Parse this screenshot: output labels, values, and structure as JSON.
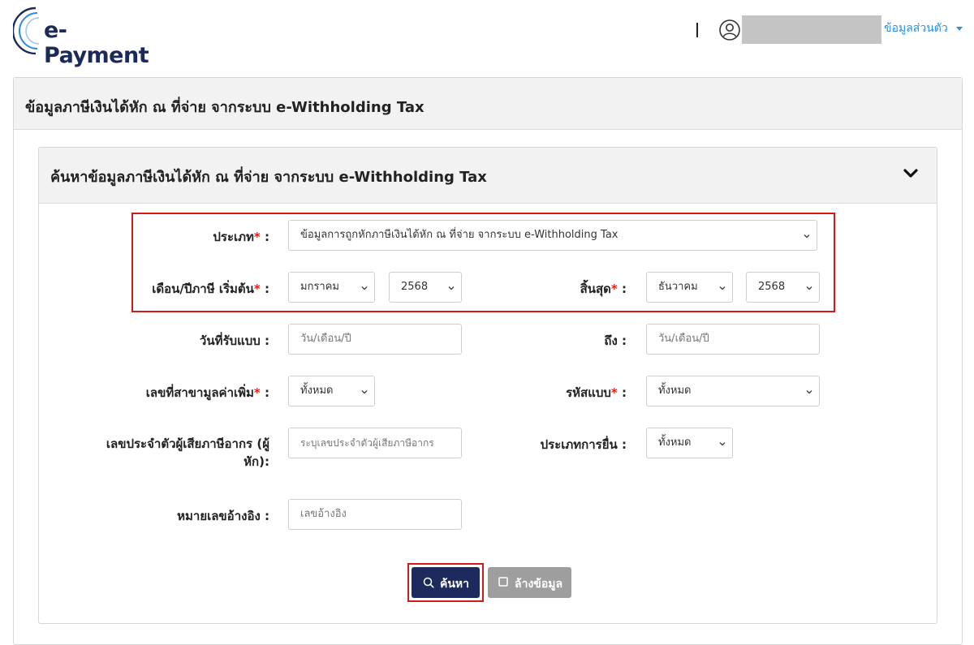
{
  "header": {
    "logo_text": "e-Payment",
    "profile_label": "ข้อมูลส่วนตัว",
    "brand_color": "#1c2a5a",
    "link_color": "#2f8ed8"
  },
  "outer": {
    "title": "ข้อมูลภาษีเงินได้หัก ณ ที่จ่าย จากระบบ e-Withholding Tax"
  },
  "search_panel": {
    "title": "ค้นหาข้อมูลภาษีเงินได้หัก ณ ที่จ่าย จากระบบ e-Withholding Tax",
    "collapse_icon": "chevron-down-icon"
  },
  "form": {
    "type": {
      "label": "ประเภท",
      "value": "ข้อมูลการถูกหักภาษีเงินได้หัก ณ ที่จ่าย จากระบบ e-Withholding Tax"
    },
    "start": {
      "label": "เดือน/ปีภาษี เริ่มต้น",
      "month": "มกราคม",
      "year": "2568"
    },
    "end": {
      "label": "สิ้นสุด",
      "month": "ธันวาคม",
      "year": "2568"
    },
    "received_date": {
      "label": "วันที่รับแบบ :",
      "placeholder": "วัน/เดือน/ปี"
    },
    "to_date": {
      "label": "ถึง :",
      "placeholder": "วัน/เดือน/ปี"
    },
    "vat_branch": {
      "label": "เลขที่สาขามูลค่าเพิ่ม",
      "value": "ทั้งหมด"
    },
    "form_code": {
      "label": "รหัสแบบ",
      "value": "ทั้งหมด"
    },
    "tax_id": {
      "label_line1": "เลขประจำตัวผู้เสียภาษีอากร (ผู้",
      "label_line2": "หัก):",
      "placeholder": "ระบุเลขประจำตัวผู้เสียภาษีอากร"
    },
    "filing_type": {
      "label": "ประเภทการยื่น :",
      "value": "ทั้งหมด"
    },
    "reference": {
      "label": "หมายเลขอ้างอิง :",
      "placeholder": "เลขอ้างอิง"
    },
    "required_mark": "*",
    "colon": " :"
  },
  "buttons": {
    "search": "ค้นหา",
    "clear": "ล้างข้อมูล",
    "search_icon": "search-icon",
    "clear_icon": "square-icon"
  }
}
